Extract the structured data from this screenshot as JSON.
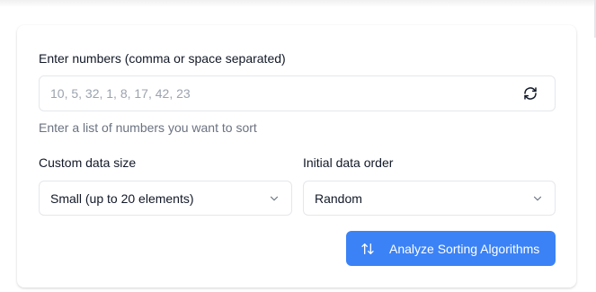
{
  "numbers_input": {
    "label": "Enter numbers (comma or space separated)",
    "placeholder": "10, 5, 32, 1, 8, 17, 42, 23",
    "value": "",
    "help_text": "Enter a list of numbers you want to sort",
    "refresh_icon": "refresh-icon"
  },
  "data_size": {
    "label": "Custom data size",
    "selected": "Small (up to 20 elements)",
    "icon": "chevron-down-icon"
  },
  "data_order": {
    "label": "Initial data order",
    "selected": "Random",
    "icon": "chevron-down-icon"
  },
  "analyze_button": {
    "label": "Analyze Sorting Algorithms",
    "icon": "sort-arrows-icon",
    "color": "#3b82f6"
  }
}
